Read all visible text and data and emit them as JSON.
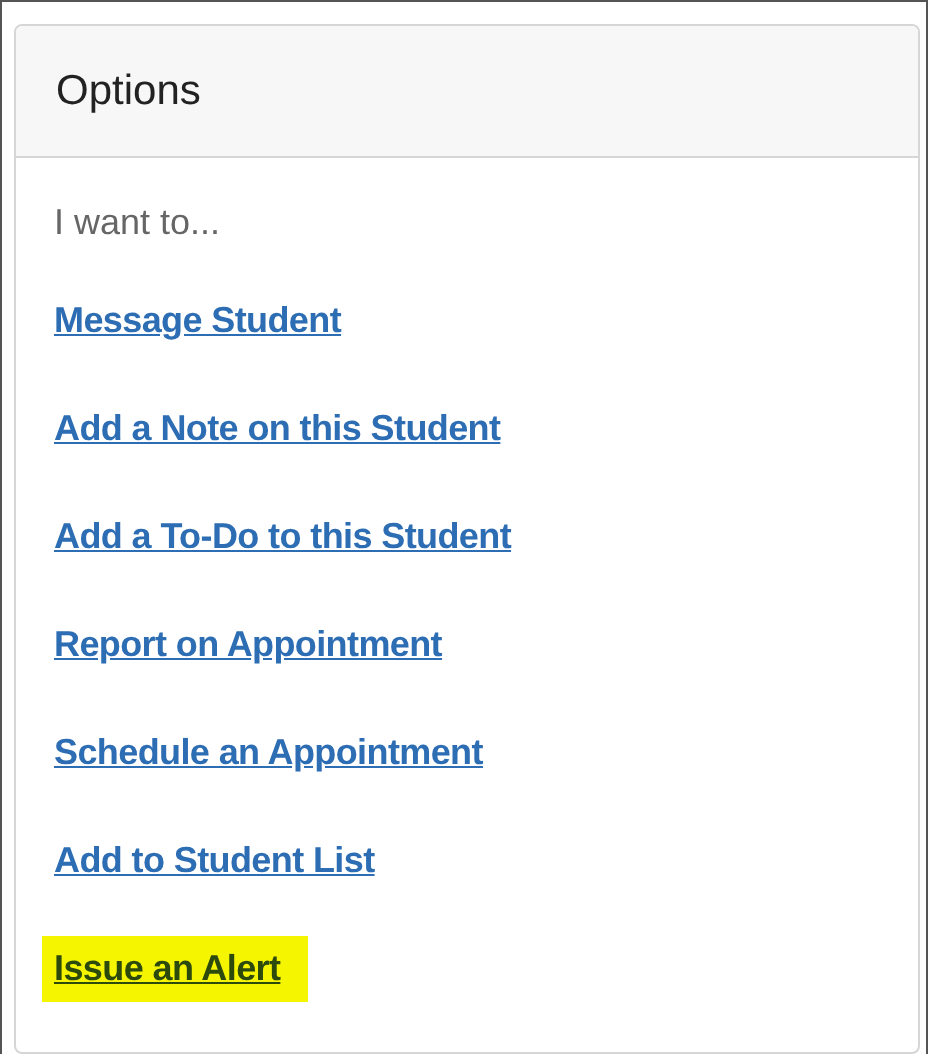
{
  "panel": {
    "title": "Options",
    "prompt": "I want to...",
    "links": [
      {
        "label": "Message Student",
        "highlighted": false
      },
      {
        "label": "Add a Note on this Student",
        "highlighted": false
      },
      {
        "label": "Add a To-Do to this Student",
        "highlighted": false
      },
      {
        "label": "Report on Appointment",
        "highlighted": false
      },
      {
        "label": "Schedule an Appointment",
        "highlighted": false
      },
      {
        "label": "Add to Student List",
        "highlighted": false
      },
      {
        "label": "Issue an Alert",
        "highlighted": true
      }
    ]
  }
}
